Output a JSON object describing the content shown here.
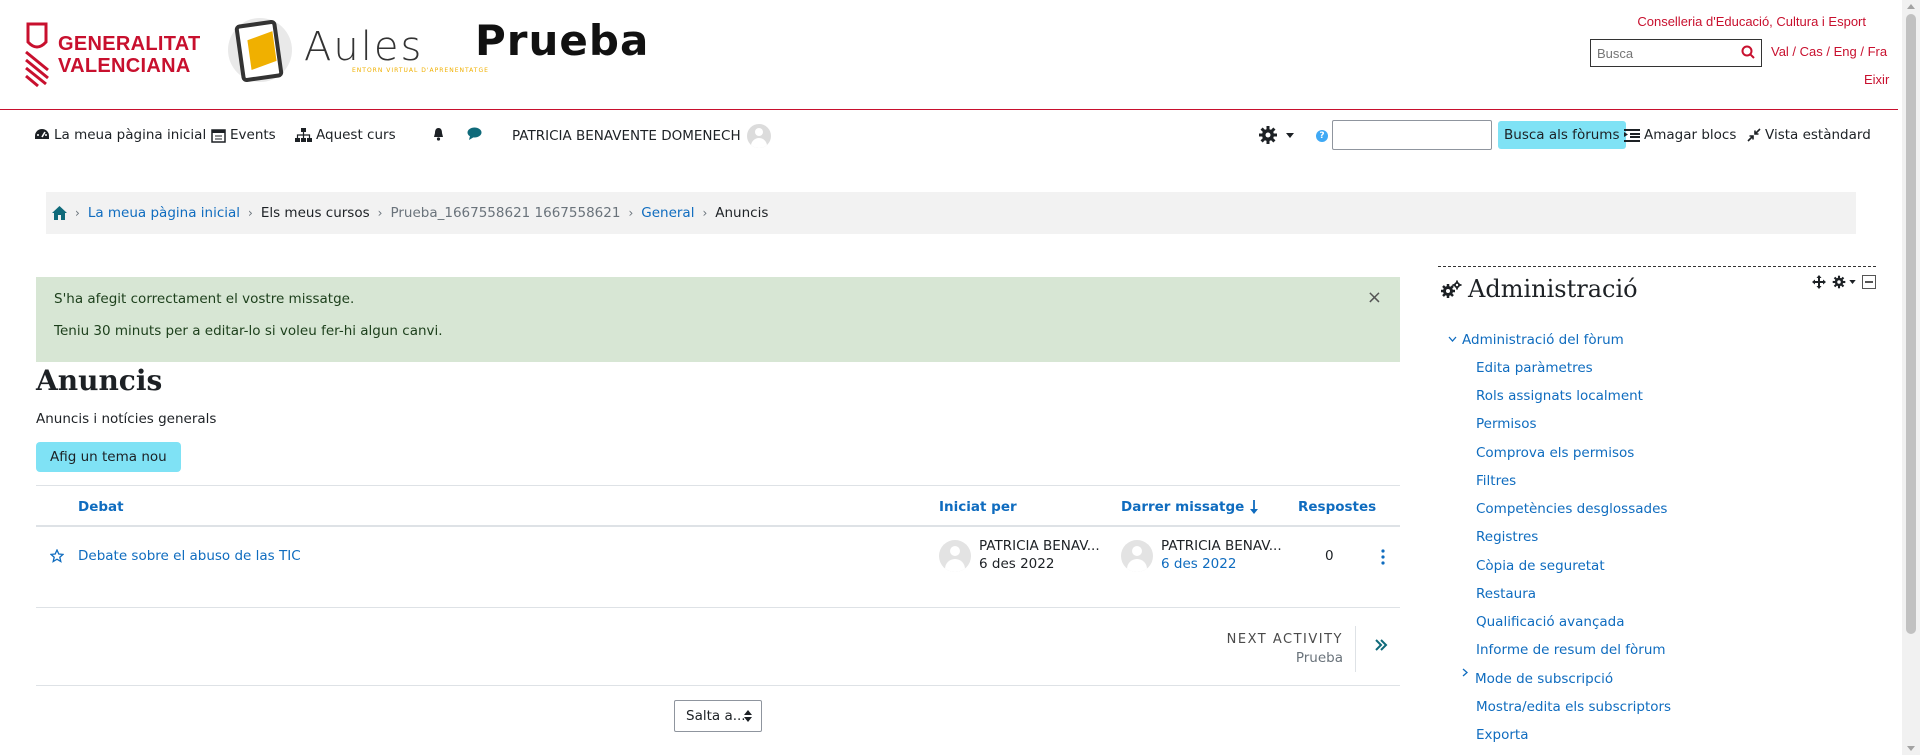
{
  "header": {
    "gv_logo_text": [
      "GENERALITAT",
      "VALENCIANA"
    ],
    "aules_wordmark": "Aules",
    "aules_subtitle": "ENTORN VIRTUAL D'APRENENTATGE",
    "site_name": "Prueba",
    "conselleria": "Conselleria d'Educació, Cultura i Esport",
    "search_placeholder": "Busca",
    "languages": "Val / Cas / Eng / Fra",
    "logout": "Eixir",
    "brand_color": "#c8102e"
  },
  "navbar": {
    "dashboard": "La meua pàgina inicial",
    "events": "Events",
    "this_course": "Aquest curs",
    "user_name": "PATRICIA BENAVENTE DOMENECH",
    "forum_search_button": "Busca als fòrums",
    "hide_blocks": "Amagar blocs",
    "standard_view": "Vista estàndard"
  },
  "breadcrumb": {
    "home_icon": "home-icon",
    "items": [
      "La meua pàgina inicial",
      "Els meus cursos",
      "Prueba_1667558621 1667558621",
      "General",
      "Anuncis"
    ]
  },
  "alert": {
    "line1": "S'ha afegit correctament el vostre missatge.",
    "line2": "Teniu 30 minuts per a editar-lo si voleu fer-hi algun canvi.",
    "close": "×"
  },
  "forum": {
    "title": "Anuncis",
    "description": "Anuncis i notícies generals",
    "add_topic": "Afig un tema nou",
    "columns": {
      "discussion": "Debat",
      "started_by": "Iniciat per",
      "last_post": "Darrer missatge",
      "replies": "Respostes"
    },
    "rows": [
      {
        "title": "Debate sobre el abuso de las TIC",
        "started_by": "PATRICIA BENAV...",
        "started_date": "6 des 2022",
        "last_by": "PATRICIA BENAV...",
        "last_date": "6 des 2022",
        "replies": "0"
      }
    ],
    "next_activity_label": "NEXT ACTIVITY",
    "next_activity_name": "Prueba",
    "jump_to": "Salta a..."
  },
  "admin": {
    "title": "Administració",
    "items": [
      "Administració del fòrum",
      "Edita paràmetres",
      "Rols assignats localment",
      "Permisos",
      "Comprova els permisos",
      "Filtres",
      "Competències desglossades",
      "Registres",
      "Còpia de seguretat",
      "Restaura",
      "Qualificació avançada",
      "Informe de resum del fòrum",
      "Mode de subscripció",
      "Mostra/edita els subscriptors",
      "Exporta"
    ]
  },
  "colors": {
    "link": "#0f6cbf",
    "button": "#7fe2f5",
    "alert_bg": "#d7e6d4"
  }
}
